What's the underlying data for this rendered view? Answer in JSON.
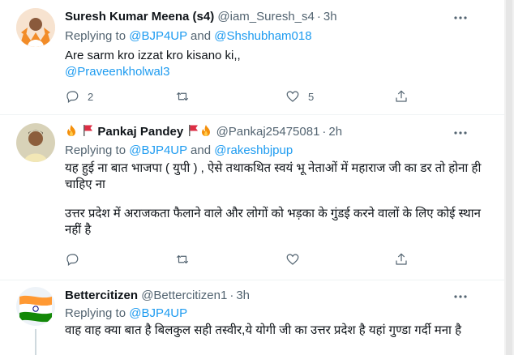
{
  "tweets": [
    {
      "name": "Suresh Kumar Meena (s4)",
      "handle": "@iam_Suresh_s4",
      "time": "3h",
      "replying_prefix": "Replying to",
      "replying_to_1": "@BJP4UP",
      "replying_and": "and",
      "replying_to_2": "@Shshubham018",
      "text_line1": "Are sarm kro izzat kro kisano ki,,",
      "text_mention": "@Praveenkholwal3",
      "replies": "2",
      "likes": "5"
    },
    {
      "name": "Pankaj Pandey",
      "handle": "@Pankaj25475081",
      "time": "2h",
      "replying_prefix": "Replying to",
      "replying_to_1": "@BJP4UP",
      "replying_and": "and",
      "replying_to_2": "@rakeshbjpup",
      "text_para1": "यह हुई ना बात भाजपा ( युपी ) , ऐसे तथाकथित  स्वयं भू नेताओं में महाराज जी का डर तो होना ही चाहिए ना",
      "text_para2": "उत्तर प्रदेश में अराजकता फैलाने वाले और लोगों को भड़का के गुंडई करने वालों के लिए कोई स्थान नहीं है",
      "replies": "",
      "likes": ""
    },
    {
      "name": "Bettercitizen",
      "handle": "@Bettercitizen1",
      "time": "3h",
      "replying_prefix": "Replying to",
      "replying_to_1": "@BJP4UP",
      "text_para1": "वाह वाह क्या बात है बिलकुल सही तस्वीर,ये योगी जी का उत्तर प्रदेश है यहां गुण्डा गर्दी मना है"
    }
  ],
  "separator_dot": "·",
  "colors": {
    "link": "#1d9bf0",
    "meta": "#536471",
    "flag_red": "#e0245e",
    "fire": "#f4900c"
  }
}
